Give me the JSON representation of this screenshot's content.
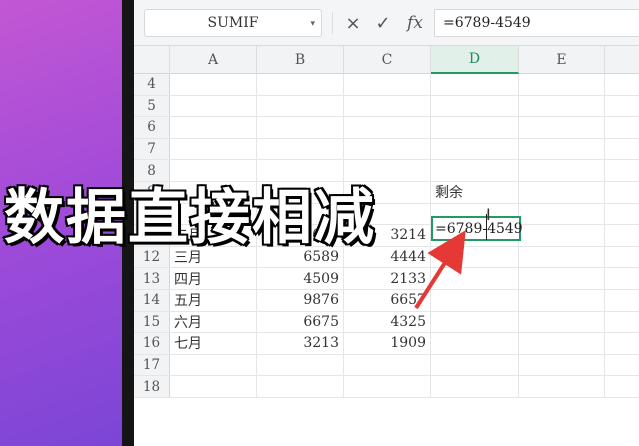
{
  "formula_bar": {
    "name_box": "SUMIF",
    "cancel_icon": "×",
    "confirm_icon": "✓",
    "fx_label": "fx",
    "formula": "=6789-4549"
  },
  "columns": [
    "A",
    "B",
    "C",
    "D",
    "E"
  ],
  "active_column": "D",
  "rows": [
    {
      "n": "4",
      "a": "",
      "b": "",
      "c": "",
      "d": ""
    },
    {
      "n": "5",
      "a": "",
      "b": "",
      "c": "",
      "d": ""
    },
    {
      "n": "6",
      "a": "",
      "b": "",
      "c": "",
      "d": ""
    },
    {
      "n": "7",
      "a": "",
      "b": "",
      "c": "",
      "d": ""
    },
    {
      "n": "8",
      "a": "",
      "b": "",
      "c": "",
      "d": ""
    },
    {
      "n": "9",
      "a": "",
      "b": "",
      "c": "",
      "d": "剩余"
    },
    {
      "n": "10",
      "a": "",
      "b": "",
      "c": "",
      "d": ""
    },
    {
      "n": "11",
      "a": "二月",
      "b": "7689",
      "c": "3214",
      "d": ""
    },
    {
      "n": "12",
      "a": "三月",
      "b": "6589",
      "c": "4444",
      "d": ""
    },
    {
      "n": "13",
      "a": "四月",
      "b": "4509",
      "c": "2133",
      "d": ""
    },
    {
      "n": "14",
      "a": "五月",
      "b": "9876",
      "c": "6657",
      "d": ""
    },
    {
      "n": "15",
      "a": "六月",
      "b": "6675",
      "c": "4325",
      "d": ""
    },
    {
      "n": "16",
      "a": "七月",
      "b": "3213",
      "c": "1909",
      "d": ""
    },
    {
      "n": "17",
      "a": "",
      "b": "",
      "c": "",
      "d": ""
    },
    {
      "n": "18",
      "a": "",
      "b": "",
      "c": "",
      "d": ""
    }
  ],
  "editing_cell": "=6789-4549",
  "caption": "数据直接相减",
  "colors": {
    "accent": "#1f9b63",
    "arrow": "#e53935",
    "background_left": "#a24bd8"
  }
}
